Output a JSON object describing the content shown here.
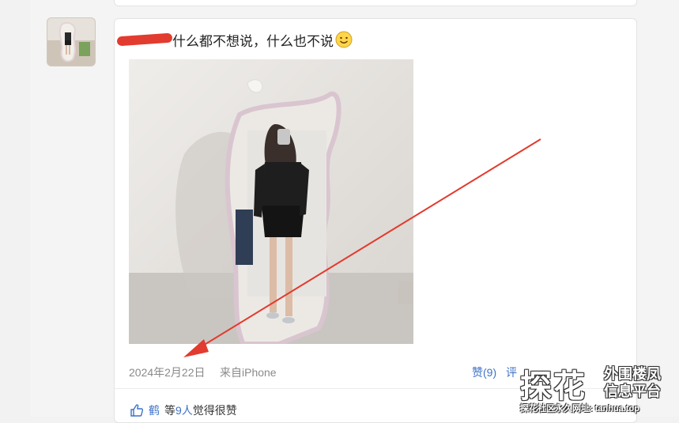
{
  "post": {
    "text": "什么都不想说，什么也不说",
    "date": "2024年2月22日",
    "source": "来自iPhone",
    "like_action": "赞(9)",
    "comment_action": "评"
  },
  "likes": {
    "name": "鹤",
    "prefix": "等",
    "count": "9人",
    "suffix": "觉得很赞"
  },
  "watermark": {
    "big": "探花",
    "line1": "外围楼凤",
    "line2": "信息平台",
    "sub": "探花社区永久网址: tanhua.top"
  },
  "colors": {
    "link": "#3d72c7",
    "annotation": "#e23b2f"
  },
  "icons": {
    "emoji": "smile-emoji-icon",
    "like": "thumbs-up-icon"
  }
}
